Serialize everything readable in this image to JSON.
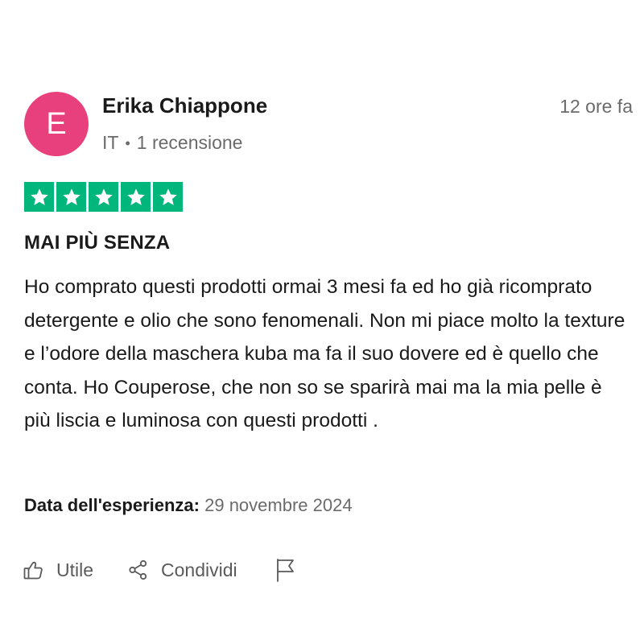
{
  "review": {
    "author": {
      "initial": "E",
      "name": "Erika Chiappone",
      "country": "IT",
      "separator": "•",
      "review_count": "1 recensione",
      "avatar_color": "#e8407d"
    },
    "time_ago": "12 ore fa",
    "rating": {
      "stars": 5,
      "max": 5,
      "color": "#00b67a",
      "icon": "star-icon"
    },
    "title": "MAI PIÙ SENZA",
    "body": "Ho comprato questi prodotti ormai 3 mesi fa ed ho già ricomprato detergente e olio che sono fenomenali. Non mi piace molto la texture e l’odore della maschera kuba ma fa il suo dovere ed è quello che conta. Ho Couperose, che non so se sparirà mai ma la mia pelle è più liscia e luminosa con questi prodotti .",
    "experience": {
      "label": "Data dell'esperienza:",
      "date": "29 novembre 2024"
    }
  },
  "actions": {
    "useful": {
      "label": "Utile",
      "icon": "thumbs-up-icon"
    },
    "share": {
      "label": "Condividi",
      "icon": "share-icon"
    },
    "report": {
      "icon": "flag-icon"
    }
  }
}
